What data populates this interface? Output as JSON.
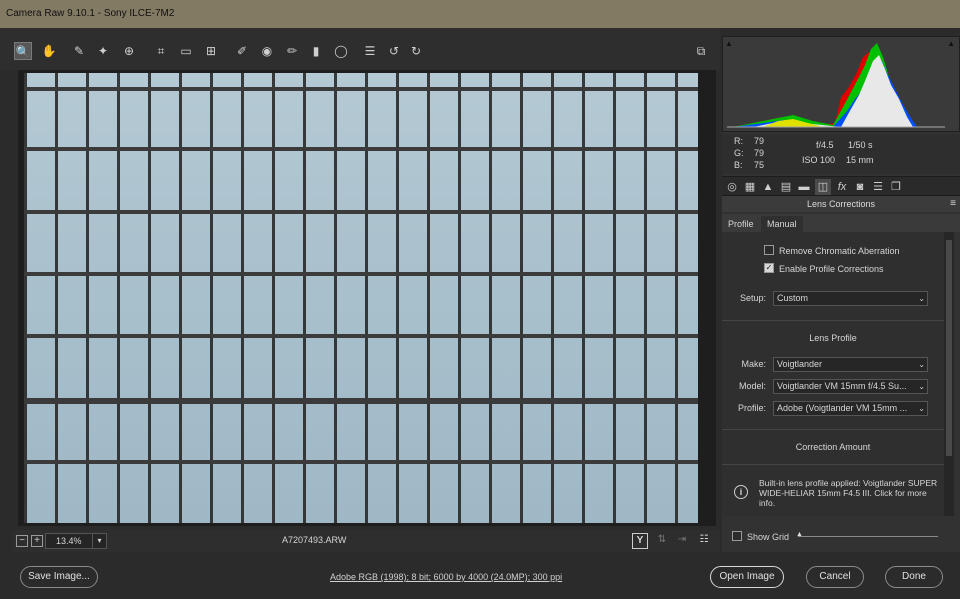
{
  "window": {
    "title": "Camera Raw 9.10.1  -  Sony ILCE-7M2"
  },
  "toolbar": {
    "tools": [
      {
        "name": "zoom-tool",
        "glyph": "🔍"
      },
      {
        "name": "hand-tool",
        "glyph": "✋"
      },
      {
        "name": "white-balance-tool",
        "glyph": "✎"
      },
      {
        "name": "color-sampler-tool",
        "glyph": "✦"
      },
      {
        "name": "targeted-adjustment-tool",
        "glyph": "⊕"
      },
      {
        "name": "crop-tool",
        "glyph": "⌗"
      },
      {
        "name": "straighten-tool",
        "glyph": "▭"
      },
      {
        "name": "transform-tool",
        "glyph": "⊞"
      },
      {
        "name": "spot-removal-tool",
        "glyph": "✐"
      },
      {
        "name": "red-eye-removal-tool",
        "glyph": "◉"
      },
      {
        "name": "adjustment-brush-tool",
        "glyph": "✏"
      },
      {
        "name": "graduated-filter-tool",
        "glyph": "▮"
      },
      {
        "name": "radial-filter-tool",
        "glyph": "◯"
      },
      {
        "name": "preferences-tool",
        "glyph": "☰"
      },
      {
        "name": "rotate-ccw-tool",
        "glyph": "↺"
      },
      {
        "name": "rotate-cw-tool",
        "glyph": "↻"
      }
    ],
    "fullscreen_icon": "⧉"
  },
  "status": {
    "zoom_out": "−",
    "zoom_in": "+",
    "zoom_level": "13.4%",
    "filename": "A7207493.ARW",
    "before_after_label": "Y"
  },
  "histogram": {
    "shadow_clip": "▲",
    "highlight_clip": "▲"
  },
  "camera_info": {
    "r_label": "R:",
    "r_value": "79",
    "g_label": "G:",
    "g_value": "79",
    "b_label": "B:",
    "b_value": "75",
    "aperture": "f/4.5",
    "shutter": "1/50 s",
    "iso": "ISO 100",
    "focal_length": "15 mm"
  },
  "panel": {
    "title": "Lens Corrections",
    "tabs": [
      "Profile",
      "Manual"
    ],
    "remove_ca_label": "Remove Chromatic Aberration",
    "remove_ca_checked": false,
    "enable_profile_label": "Enable Profile Corrections",
    "enable_profile_checked": true,
    "setup_label": "Setup:",
    "setup_value": "Custom",
    "lens_profile_heading": "Lens Profile",
    "make_label": "Make:",
    "make_value": "Voigtlander",
    "model_label": "Model:",
    "model_value": "Voigtlander VM 15mm f/4.5 Su...",
    "profile_label": "Profile:",
    "profile_value": "Adobe (Voigtlander VM 15mm ...",
    "correction_amount_heading": "Correction Amount",
    "info_text": "Built-in lens profile applied: Voigtlander SUPER WIDE-HELIAR 15mm F4.5 III.  Click for more info.",
    "show_grid_label": "Show Grid"
  },
  "bottom": {
    "save_image": "Save Image...",
    "workflow": "Adobe RGB (1998); 8 bit; 6000 by 4000 (24.0MP); 300 ppi",
    "open_image": "Open Image",
    "cancel": "Cancel",
    "done": "Done"
  }
}
